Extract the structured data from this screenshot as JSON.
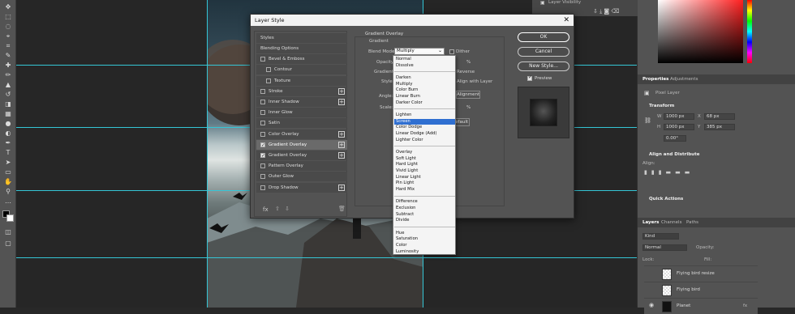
{
  "panels": {
    "layer_visibility_label": "Layer Visibility",
    "tabs_top": [
      "Properties",
      "Adjustments"
    ],
    "pixel_layer_label": "Pixel Layer",
    "transform_title": "Transform",
    "w_label": "W",
    "w_value": "1000 px",
    "h_label": "H",
    "h_value": "1000 px",
    "x_label": "X",
    "x_value": "68 px",
    "y_label": "Y",
    "y_value": "385 px",
    "angle_value": "0.00°",
    "align_title": "Align and Distribute",
    "align_label": "Align:",
    "quick_actions_title": "Quick Actions",
    "layer_tabs": [
      "Layers",
      "Channels",
      "Paths"
    ],
    "search_placeholder": "Kind",
    "blend_value": "Normal",
    "opacity_label": "Opacity:",
    "lock_label": "Lock:",
    "fill_label": "Fill:",
    "layers": [
      "Flying bird resize",
      "Flying bird",
      "Planet"
    ],
    "fx_label": "fx"
  },
  "dialog": {
    "title": "Layer Style",
    "styles_header": "Styles",
    "style_items": [
      {
        "label": "Blending Options",
        "checkbox": false,
        "checked": false,
        "plus": false,
        "indent": false,
        "selected": false
      },
      {
        "label": "Bevel & Emboss",
        "checkbox": true,
        "checked": false,
        "plus": false,
        "indent": false,
        "selected": false
      },
      {
        "label": "Contour",
        "checkbox": true,
        "checked": false,
        "plus": false,
        "indent": true,
        "selected": false
      },
      {
        "label": "Texture",
        "checkbox": true,
        "checked": false,
        "plus": false,
        "indent": true,
        "selected": false
      },
      {
        "label": "Stroke",
        "checkbox": true,
        "checked": false,
        "plus": true,
        "indent": false,
        "selected": false
      },
      {
        "label": "Inner Shadow",
        "checkbox": true,
        "checked": false,
        "plus": true,
        "indent": false,
        "selected": false
      },
      {
        "label": "Inner Glow",
        "checkbox": true,
        "checked": false,
        "plus": false,
        "indent": false,
        "selected": false
      },
      {
        "label": "Satin",
        "checkbox": true,
        "checked": false,
        "plus": false,
        "indent": false,
        "selected": false
      },
      {
        "label": "Color Overlay",
        "checkbox": true,
        "checked": false,
        "plus": true,
        "indent": false,
        "selected": false
      },
      {
        "label": "Gradient Overlay",
        "checkbox": true,
        "checked": true,
        "plus": true,
        "indent": false,
        "selected": true
      },
      {
        "label": "Gradient Overlay",
        "checkbox": true,
        "checked": true,
        "plus": true,
        "indent": false,
        "selected": false
      },
      {
        "label": "Pattern Overlay",
        "checkbox": true,
        "checked": false,
        "plus": false,
        "indent": false,
        "selected": false
      },
      {
        "label": "Outer Glow",
        "checkbox": true,
        "checked": false,
        "plus": false,
        "indent": false,
        "selected": false
      },
      {
        "label": "Drop Shadow",
        "checkbox": true,
        "checked": false,
        "plus": true,
        "indent": false,
        "selected": false
      }
    ],
    "fx_footer": "fx",
    "section_title": "Gradient Overlay",
    "sub_title": "Gradient",
    "blend_mode_label": "Blend Mode:",
    "blend_mode_value": "Multiply",
    "dither_label": "Dither",
    "opacity_label": "Opacity:",
    "percent": "%",
    "gradient_label": "Gradient:",
    "reverse_label": "Reverse",
    "style_label": "Style:",
    "align_with_layer_label": "Align with Layer",
    "angle_label": "Angle:",
    "alignment_label": "Alignment",
    "scale_label": "Scale:",
    "percent2": "%",
    "default_label": "Default",
    "ok_label": "OK",
    "cancel_label": "Cancel",
    "new_style_label": "New Style...",
    "preview_label": "Preview"
  },
  "blend_modes": [
    [
      "Normal",
      "Dissolve"
    ],
    [
      "Darken",
      "Multiply",
      "Color Burn",
      "Linear Burn",
      "Darker Color"
    ],
    [
      "Lighten",
      "Screen",
      "Color Dodge",
      "Linear Dodge (Add)",
      "Lighter Color"
    ],
    [
      "Overlay",
      "Soft Light",
      "Hard Light",
      "Vivid Light",
      "Linear Light",
      "Pin Light",
      "Hard Mix"
    ],
    [
      "Difference",
      "Exclusion",
      "Subtract",
      "Divide"
    ],
    [
      "Hue",
      "Saturation",
      "Color",
      "Luminosity"
    ]
  ],
  "selected_blend_mode": "Screen",
  "colors": {
    "guide": "#35c6d6",
    "selection": "#2f6fd1",
    "dialog_bg": "#535353"
  }
}
